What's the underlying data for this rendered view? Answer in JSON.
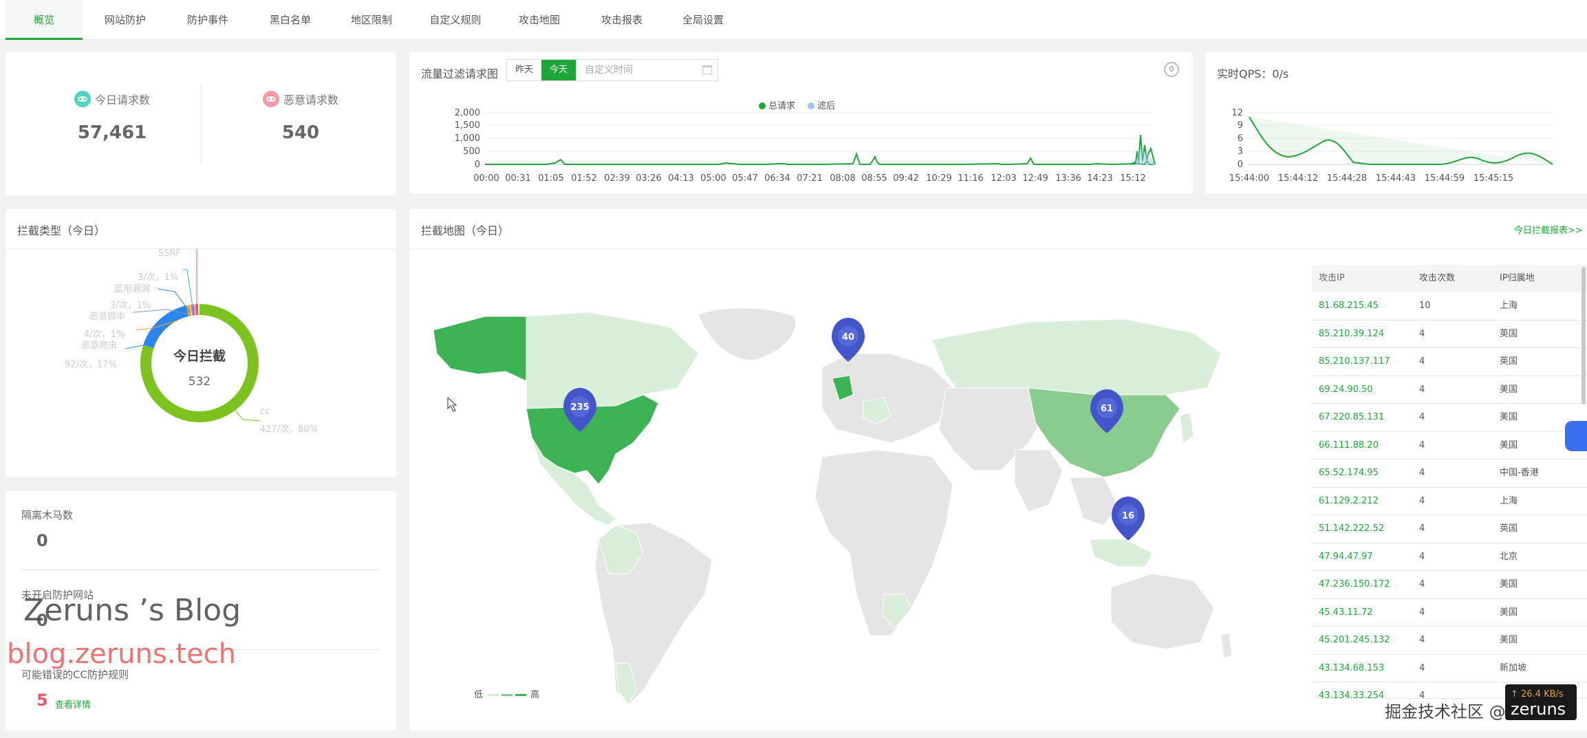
{
  "nav": {
    "tabs": [
      {
        "label": "概览",
        "active": true
      },
      {
        "label": "网站防护"
      },
      {
        "label": "防护事件"
      },
      {
        "label": "黑白名单"
      },
      {
        "label": "地区限制"
      },
      {
        "label": "自定义规则"
      },
      {
        "label": "攻击地图"
      },
      {
        "label": "攻击报表"
      },
      {
        "label": "全局设置"
      }
    ]
  },
  "stats": {
    "today_requests_label": "今日请求数",
    "today_requests_value": "57,461",
    "malicious_requests_label": "恶意请求数",
    "malicious_requests_value": "540"
  },
  "traffic": {
    "title": "流量过滤请求图",
    "btn_yesterday": "昨天",
    "btn_today": "今天",
    "custom_time_placeholder": "自定义时间",
    "badge": "0",
    "legend_total": "总请求",
    "legend_filtered": "滤后"
  },
  "qps": {
    "title": "实时QPS：0/s"
  },
  "block_types": {
    "title": "拦截类型（今日）",
    "center_title": "今日拦截",
    "center_value": "532",
    "labels": {
      "top": "SSRF",
      "l1": "3/次，1%",
      "l2": "蓝用漏洞",
      "l3": "3/次，1%",
      "l4": "恶意脚本",
      "l5": "4/次，1%",
      "l6": "恶意爬虫",
      "l7": "92/次，17%",
      "r1": "cc",
      "r2": "427/次，80%"
    }
  },
  "stats2": {
    "trojan_label": "隔离木马数",
    "trojan_value": "0",
    "unprotected_label": "未开启防护网站",
    "unprotected_value": "0",
    "cc_label": "可能错误的CC防护规则",
    "cc_value": "5",
    "cc_link": "查看详情"
  },
  "attack_map": {
    "title": "拦截地图（今日）",
    "report_link": "今日拦截报表>>",
    "legend_low": "低",
    "legend_high": "高",
    "pins": [
      {
        "value": "235"
      },
      {
        "value": "40"
      },
      {
        "value": "61"
      },
      {
        "value": "16"
      }
    ]
  },
  "attack_table": {
    "headers": [
      "攻击IP",
      "攻击次数",
      "IP归属地"
    ],
    "rows": [
      {
        "ip": "81.68.215.45",
        "count": "10",
        "loc": "上海"
      },
      {
        "ip": "85.210.39.124",
        "count": "4",
        "loc": "英国"
      },
      {
        "ip": "85.210.137.117",
        "count": "4",
        "loc": "英国"
      },
      {
        "ip": "69.24.90.50",
        "count": "4",
        "loc": "美国"
      },
      {
        "ip": "67.220.85.131",
        "count": "4",
        "loc": "美国"
      },
      {
        "ip": "66.111.88.20",
        "count": "4",
        "loc": "美国"
      },
      {
        "ip": "65.52.174.95",
        "count": "4",
        "loc": "中国-香港"
      },
      {
        "ip": "61.129.2.212",
        "count": "4",
        "loc": "上海"
      },
      {
        "ip": "51.142.222.52",
        "count": "4",
        "loc": "英国"
      },
      {
        "ip": "47.94.47.97",
        "count": "4",
        "loc": "北京"
      },
      {
        "ip": "47.236.150.172",
        "count": "4",
        "loc": "美国"
      },
      {
        "ip": "45.43.11.72",
        "count": "4",
        "loc": "美国"
      },
      {
        "ip": "45.201.245.132",
        "count": "4",
        "loc": "美国"
      },
      {
        "ip": "43.134.68.153",
        "count": "4",
        "loc": "新加坡"
      },
      {
        "ip": "43.134.33.254",
        "count": "4",
        "loc": ""
      }
    ]
  },
  "watermark": {
    "blog_name": "Zeruns ’s Blog",
    "blog_url": "blog.zeruns.tech",
    "juejin": "掘金技术社区 @ zeruns"
  },
  "speed": {
    "rate": "↑ 26.4 KB/s",
    "user": "zeruns"
  },
  "colors": {
    "accent": "#20a53a",
    "donut_green": "#7cc31f",
    "donut_blue": "#2a85ee"
  }
}
